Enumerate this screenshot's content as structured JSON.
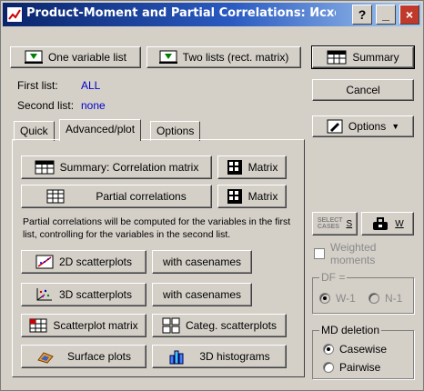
{
  "window": {
    "title": "Product-Moment and Partial Correlations: Исхо",
    "help_btn": "?",
    "min_btn": "_",
    "close_btn": "×"
  },
  "top_buttons": {
    "one_list": "One variable list",
    "two_lists": "Two lists (rect. matrix)"
  },
  "lists": {
    "first_label": "First list:",
    "first_value": "ALL",
    "second_label": "Second list:",
    "second_value": "none"
  },
  "tabs": [
    "Quick",
    "Advanced/plot",
    "Options"
  ],
  "active_tab": "Advanced/plot",
  "panel": {
    "summary_corr": "Summary:  Correlation matrix",
    "matrix1": "Matrix",
    "partial_corr": "Partial correlations",
    "matrix2": "Matrix",
    "note": "Partial correlations will be computed for the variables in the first list, controlling for the variables in the second list.",
    "scatter2d": "2D scatterplots",
    "scatter3d": "3D scatterplots",
    "casenames1": "with casenames",
    "casenames2": "with casenames",
    "scatter_matrix": "Scatterplot matrix",
    "categ_scatter": "Categ. scatterplots",
    "surface": "Surface plots",
    "hist3d": "3D histograms"
  },
  "right": {
    "summary": "Summary",
    "cancel": "Cancel",
    "options": "Options",
    "select_cases_top": "SELECT",
    "select_cases_bottom": "CASES",
    "s_key": "S",
    "w_key": "W",
    "weighted": "Weighted moments",
    "df_title": "DF =",
    "df_w1": "W-1",
    "df_n1": "N-1",
    "md_title": "MD deletion",
    "casewise": "Casewise",
    "pairwise": "Pairwise"
  },
  "colors": {
    "face": "#d4d0c8",
    "title_start": "#0a246a",
    "title_end": "#a6caf0",
    "close": "#c0392b",
    "link_blue": "#0000cc"
  }
}
